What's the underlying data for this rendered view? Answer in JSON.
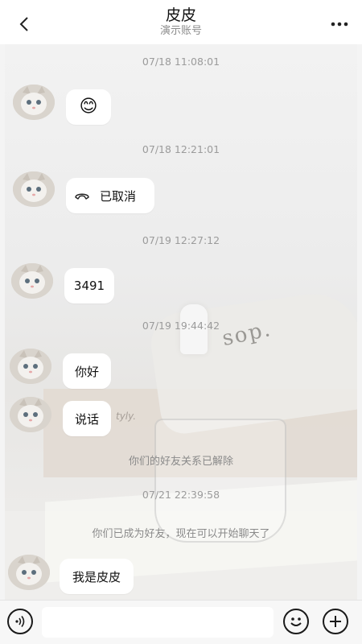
{
  "header": {
    "title": "皮皮",
    "subtitle": "演示账号",
    "back_icon": "chevron-left-icon",
    "more_icon": "more-horizontal-icon"
  },
  "chat": {
    "background_text": {
      "bag_text": "sop.",
      "box_text": "tyly."
    },
    "messages": [
      {
        "timestamp": "07/18 11:08:01",
        "content": "😊",
        "type": "emoji"
      },
      {
        "timestamp": "07/18 12:21:01",
        "content": "已取消",
        "type": "call",
        "icon": "phone-hangup-icon"
      },
      {
        "timestamp": "07/19 12:27:12",
        "content": "3491",
        "type": "text"
      },
      {
        "timestamp": "07/19 19:44:42",
        "content": "你好",
        "type": "text"
      },
      {
        "timestamp": "",
        "content": "说话",
        "type": "text"
      },
      {
        "timestamp": "07/21 22:39:58",
        "content": "我是皮皮",
        "type": "text"
      }
    ],
    "system_notices": [
      "你们的好友关系已解除",
      "你们已成为好友，现在可以开始聊天了"
    ]
  },
  "input_bar": {
    "voice_icon": "voice-icon",
    "input_value": "",
    "input_placeholder": "",
    "emoji_icon": "smiley-icon",
    "plus_icon": "plus-icon"
  },
  "colors": {
    "bubble": "#ffffff",
    "timestamp": "#9b9b9b",
    "header_bg": "#ffffff"
  }
}
